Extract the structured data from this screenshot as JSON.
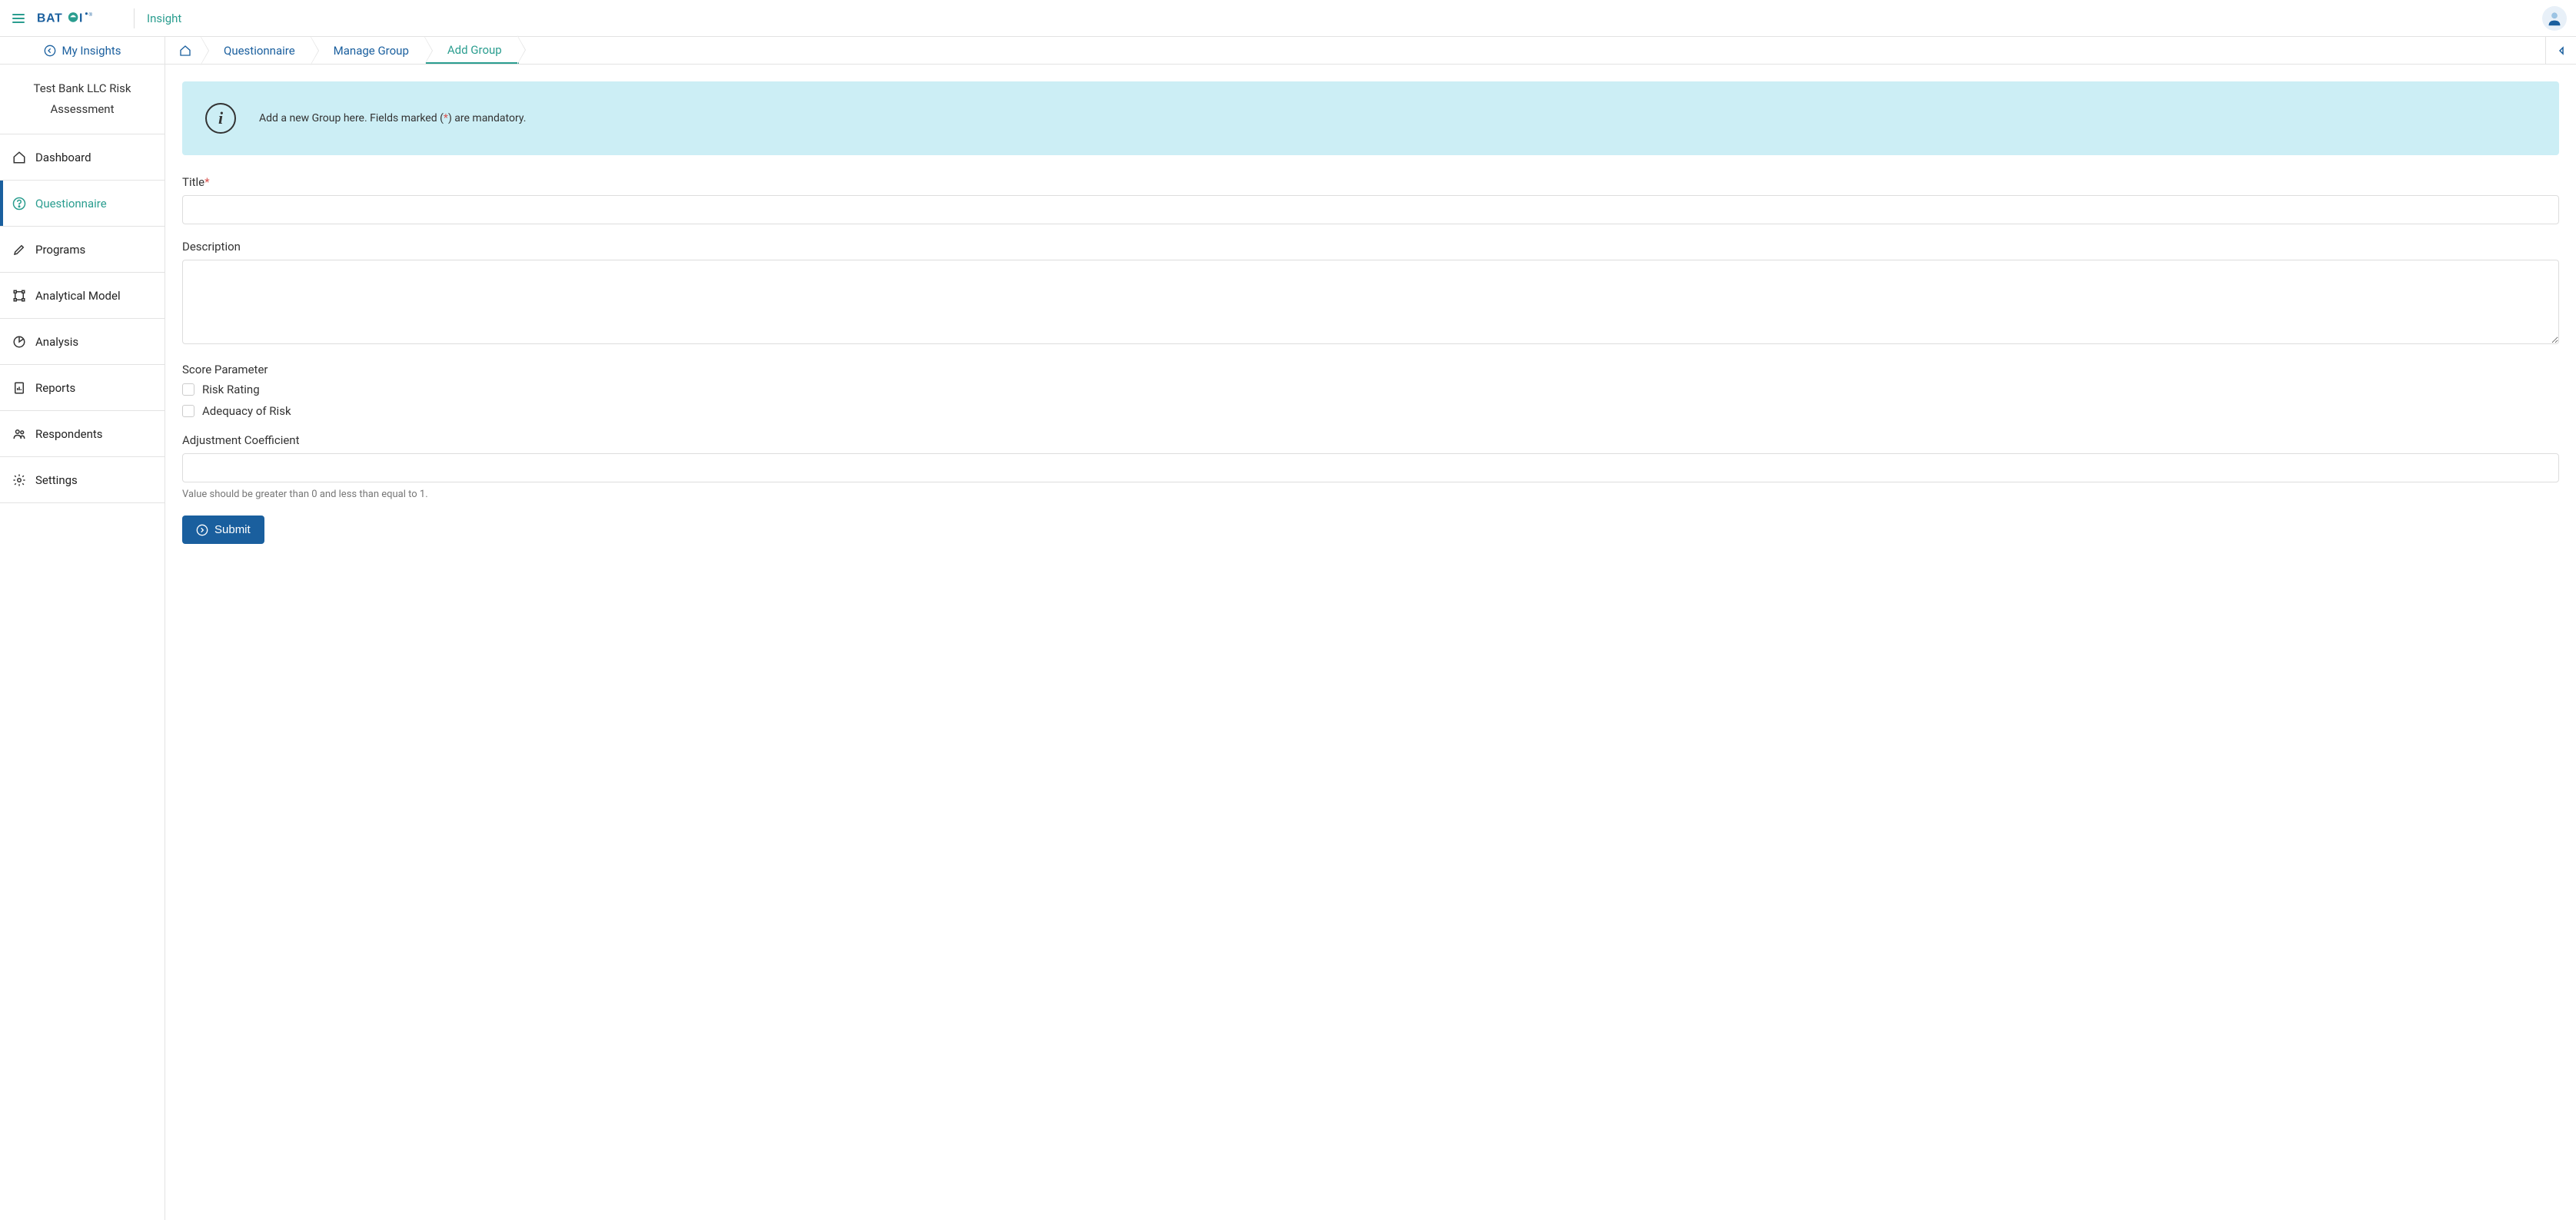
{
  "header": {
    "app_section": "Insight"
  },
  "sidebar": {
    "my_insights_label": "My Insights",
    "project_title": "Test Bank LLC Risk Assessment",
    "items": [
      {
        "label": "Dashboard"
      },
      {
        "label": "Questionnaire"
      },
      {
        "label": "Programs"
      },
      {
        "label": "Analytical Model"
      },
      {
        "label": "Analysis"
      },
      {
        "label": "Reports"
      },
      {
        "label": "Respondents"
      },
      {
        "label": "Settings"
      }
    ]
  },
  "breadcrumbs": {
    "items": [
      {
        "label": "Questionnaire"
      },
      {
        "label": "Manage Group"
      },
      {
        "label": "Add Group"
      }
    ]
  },
  "info_banner": {
    "text_before": "Add a new Group here. Fields marked (",
    "asterisk": "*",
    "text_after": ") are mandatory."
  },
  "form": {
    "title_label": "Title",
    "title_value": "",
    "description_label": "Description",
    "description_value": "",
    "score_parameter_label": "Score Parameter",
    "score_options": [
      {
        "label": "Risk Rating"
      },
      {
        "label": "Adequacy of Risk"
      }
    ],
    "adjustment_label": "Adjustment Coefficient",
    "adjustment_value": "",
    "adjustment_help": "Value should be greater than 0 and less than equal to 1.",
    "submit_label": "Submit"
  }
}
